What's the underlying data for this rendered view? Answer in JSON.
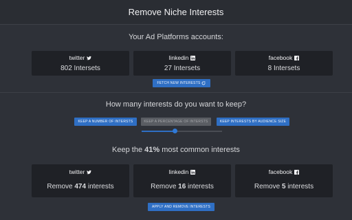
{
  "header": {
    "title": "Remove Niche Interests"
  },
  "accounts": {
    "heading": "Your Ad Platforms accounts:",
    "items": [
      {
        "network": "twitter",
        "icon": "twitter-bird-icon",
        "value": "802 Intersets"
      },
      {
        "network": "linkedin",
        "icon": "linkedin-icon",
        "value": "27 Intersets"
      },
      {
        "network": "facebook",
        "icon": "facebook-icon",
        "value": "8 Intersets"
      }
    ],
    "fetch_button": "FETCH NEW INTERESTS"
  },
  "keep": {
    "question": "How many interests do you want to keep?",
    "modes": [
      {
        "label": "KEEP A NUMBER OF INTERSTS",
        "active": true
      },
      {
        "label": "KEEP A PERCENTAGE OF INTERSTS",
        "active": false
      },
      {
        "label": "KEEP INTERESTS BY AUDIENCE SIZE",
        "active": true
      }
    ],
    "slider_value": 0.41
  },
  "summary": {
    "prefix": "Keep the ",
    "percent": "41%",
    "suffix": " most common interests",
    "items": [
      {
        "network": "twitter",
        "icon": "twitter-bird-icon",
        "pre": "Remove ",
        "count": "474",
        "post": " interests"
      },
      {
        "network": "linkedin",
        "icon": "linkedin-icon",
        "pre": "Remove ",
        "count": "16",
        "post": " interests"
      },
      {
        "network": "facebook",
        "icon": "facebook-icon",
        "pre": "Remove ",
        "count": "5",
        "post": " interests"
      }
    ],
    "apply_button": "APPLY AND REMOVE INTERESTS"
  },
  "colors": {
    "accent": "#2f6fc4",
    "background": "#2e3138",
    "card": "#1f2126"
  }
}
